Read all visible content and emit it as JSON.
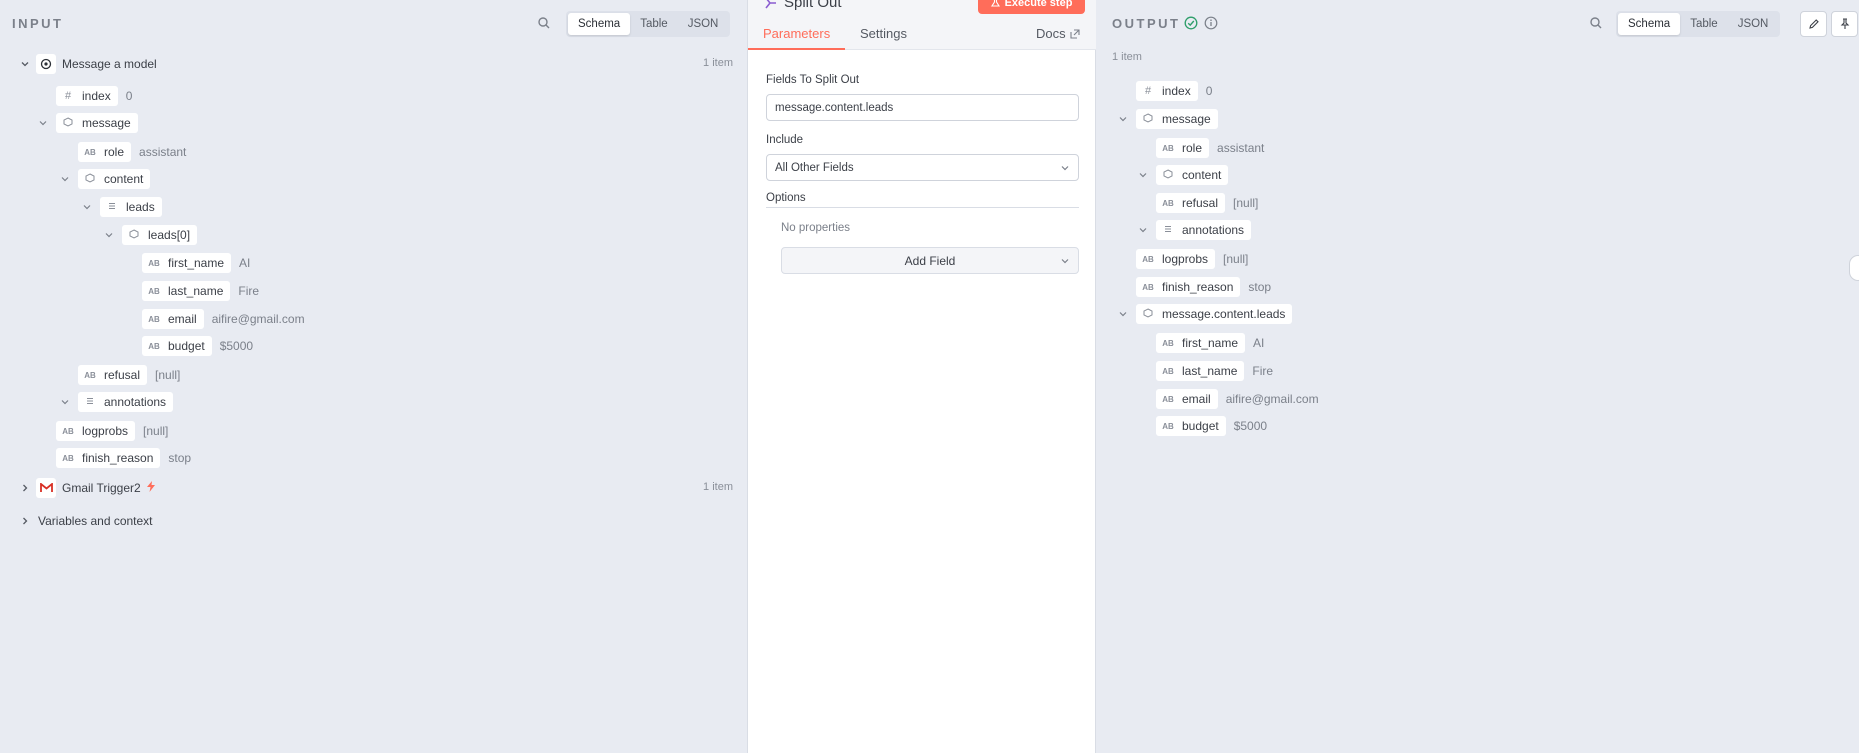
{
  "input": {
    "title": "INPUT",
    "view_tabs": [
      "Schema",
      "Table",
      "JSON"
    ],
    "nodes": [
      {
        "label": "Message a model",
        "count": "1 item"
      },
      {
        "label": "Gmail Trigger2",
        "count": "1 item"
      },
      {
        "label": "Variables and context"
      }
    ],
    "fields": {
      "index": {
        "name": "index",
        "value": "0"
      },
      "message": {
        "name": "message"
      },
      "role": {
        "name": "role",
        "value": "assistant"
      },
      "content": {
        "name": "content"
      },
      "leads": {
        "name": "leads"
      },
      "leads0": {
        "name": "leads[0]"
      },
      "first_name": {
        "name": "first_name",
        "value": "AI"
      },
      "last_name": {
        "name": "last_name",
        "value": "Fire"
      },
      "email": {
        "name": "email",
        "value": "aifire@gmail.com"
      },
      "budget": {
        "name": "budget",
        "value": "$5000"
      },
      "refusal": {
        "name": "refusal",
        "value": "[null]"
      },
      "annotations": {
        "name": "annotations"
      },
      "logprobs": {
        "name": "logprobs",
        "value": "[null]"
      },
      "finish_reason": {
        "name": "finish_reason",
        "value": "stop"
      }
    }
  },
  "node_panel": {
    "title": "Split Out",
    "execute_label": "Execute step",
    "tabs": {
      "parameters": "Parameters",
      "settings": "Settings",
      "docs": "Docs"
    },
    "fields_to_split_label": "Fields To Split Out",
    "fields_to_split_value": "message.content.leads",
    "include_label": "Include",
    "include_value": "All Other Fields",
    "options_label": "Options",
    "no_properties": "No properties",
    "add_field_label": "Add Field"
  },
  "output": {
    "title": "OUTPUT",
    "count": "1 item",
    "view_tabs": [
      "Schema",
      "Table",
      "JSON"
    ],
    "fields": {
      "index": {
        "name": "index",
        "value": "0"
      },
      "message": {
        "name": "message"
      },
      "role": {
        "name": "role",
        "value": "assistant"
      },
      "content": {
        "name": "content"
      },
      "refusal": {
        "name": "refusal",
        "value": "[null]"
      },
      "annotations": {
        "name": "annotations"
      },
      "logprobs": {
        "name": "logprobs",
        "value": "[null]"
      },
      "finish_reason": {
        "name": "finish_reason",
        "value": "stop"
      },
      "leads": {
        "name": "message.content.leads"
      },
      "first_name": {
        "name": "first_name",
        "value": "AI"
      },
      "last_name": {
        "name": "last_name",
        "value": "Fire"
      },
      "email": {
        "name": "email",
        "value": "aifire@gmail.com"
      },
      "budget": {
        "name": "budget",
        "value": "$5000"
      }
    }
  },
  "colors": {
    "accent": "#ff6d5a",
    "success": "#2e9e6a",
    "panel_bg": "#e8ebf2"
  }
}
